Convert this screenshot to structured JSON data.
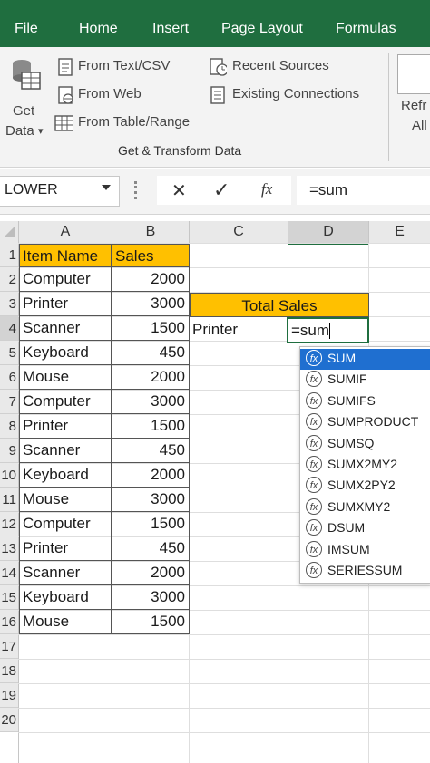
{
  "tabs": [
    "File",
    "Home",
    "Insert",
    "Page Layout",
    "Formulas"
  ],
  "ribbon": {
    "get_data_line1": "Get",
    "get_data_line2": "Data",
    "get_data_arrow": "▾",
    "from_text_csv": "From Text/CSV",
    "from_web": "From Web",
    "from_table_range": "From Table/Range",
    "recent_sources": "Recent Sources",
    "existing_connections": "Existing Connections",
    "refresh_line1": "Refr",
    "refresh_line2": "All",
    "group_label": "Get & Transform Data"
  },
  "formula_bar": {
    "name_box": "LOWER",
    "cancel_symbol": "✕",
    "enter_symbol": "✓",
    "fx_symbol": "fx",
    "formula": "=sum"
  },
  "columns": [
    "A",
    "B",
    "C",
    "D",
    "E"
  ],
  "rows": [
    "1",
    "2",
    "3",
    "4",
    "5",
    "6",
    "7",
    "8",
    "9",
    "10",
    "11",
    "12",
    "13",
    "14",
    "15",
    "16",
    "17",
    "18",
    "19",
    "20"
  ],
  "table": {
    "header_item": "Item Name",
    "header_sales": "Sales",
    "items": [
      "Computer",
      "Printer",
      "Scanner",
      "Keyboard",
      "Mouse",
      "Computer",
      "Printer",
      "Scanner",
      "Keyboard",
      "Mouse",
      "Computer",
      "Printer",
      "Scanner",
      "Keyboard",
      "Mouse"
    ],
    "sales": [
      "2000",
      "3000",
      "1500",
      "450",
      "2000",
      "3000",
      "1500",
      "450",
      "2000",
      "3000",
      "1500",
      "450",
      "2000",
      "3000",
      "1500"
    ]
  },
  "summary": {
    "title": "Total Sales",
    "label": "Printer",
    "editing": "=sum"
  },
  "autocomplete": [
    "SUM",
    "SUMIF",
    "SUMIFS",
    "SUMPRODUCT",
    "SUMSQ",
    "SUMX2MY2",
    "SUMX2PY2",
    "SUMXMY2",
    "DSUM",
    "IMSUM",
    "SERIESSUM"
  ],
  "colors": {
    "ribbon_green": "#1f6e3f",
    "header_yellow": "#ffc000",
    "selection_blue": "#1f6fd0"
  }
}
